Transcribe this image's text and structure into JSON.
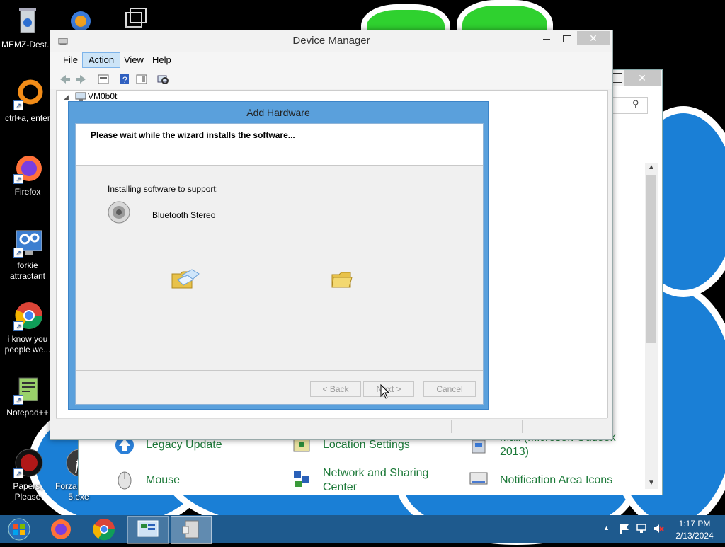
{
  "desktop": {
    "icons": [
      {
        "label": "MEMZ-Dest...",
        "icon": "recycle-bin-icon"
      },
      {
        "label": "ctrl+a, enter",
        "icon": "orange-ring-icon"
      },
      {
        "label": "Firefox",
        "icon": "firefox-icon"
      },
      {
        "label": "forkie attractant",
        "icon": "gear-monitor-icon"
      },
      {
        "label": "i know you people we...",
        "icon": "chrome-icon"
      },
      {
        "label": "Notepad++",
        "icon": "notepadpp-icon"
      },
      {
        "label": "Papers, Please",
        "icon": "papers-please-icon"
      },
      {
        "label": "Forza Hori... 5.exe",
        "icon": "flash-icon"
      }
    ]
  },
  "control_panel": {
    "items": [
      {
        "label": "Legacy Update",
        "icon": "legacy-update-icon"
      },
      {
        "label": "Location Settings",
        "icon": "location-icon"
      },
      {
        "label": "Mail (Microsoft Outlook 2013)",
        "icon": "mail-icon"
      },
      {
        "label": "Mouse",
        "icon": "mouse-icon"
      },
      {
        "label": "Network and Sharing Center",
        "icon": "network-icon"
      },
      {
        "label": "Notification Area Icons",
        "icon": "notification-area-icon"
      }
    ]
  },
  "device_manager": {
    "title": "Device Manager",
    "menu": [
      "File",
      "Action",
      "View",
      "Help"
    ],
    "active_menu": "Action",
    "tree_root": "VM0b0t"
  },
  "wizard": {
    "title": "Add Hardware",
    "heading": "Please wait while the wizard installs the software...",
    "installing_label": "Installing software to support:",
    "device_name": "Bluetooth Stereo",
    "buttons": {
      "back": "< Back",
      "next": "Next >",
      "cancel": "Cancel"
    }
  },
  "taskbar": {
    "time": "1:17 PM",
    "date": "2/13/2024",
    "pinned": [
      "start-orb",
      "firefox",
      "chrome",
      "control-panel",
      "device-manager"
    ]
  },
  "colors": {
    "taskbar": "#1e5a8e",
    "wizard_frame": "#5aa0dc",
    "cp_link": "#1e7a3a"
  }
}
